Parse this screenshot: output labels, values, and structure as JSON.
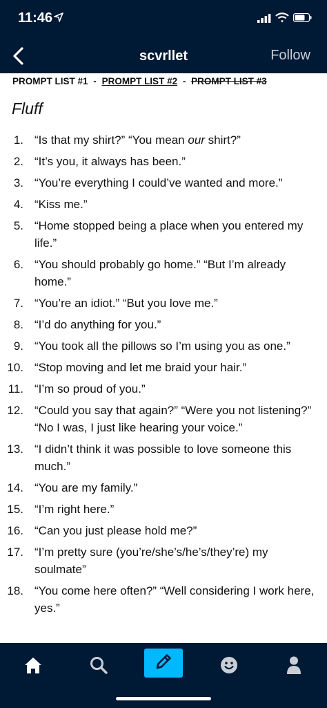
{
  "status": {
    "time": "11:46",
    "icons": [
      "location-arrow-icon",
      "signal-icon",
      "wifi-icon",
      "battery-icon"
    ]
  },
  "nav": {
    "back_icon": "chevron-left-icon",
    "title": "scvrllet",
    "follow_label": "Follow"
  },
  "prompt_links": {
    "link1": "PROMPT LIST #1",
    "sep1": "-",
    "link2": "PROMPT LIST #2",
    "sep2": "-",
    "link3": "PROMPT LIST #3"
  },
  "section_title": "Fluff",
  "prompts": [
    {
      "num": "1.",
      "text": "“Is that my shirt?” “You mean ",
      "em": "our",
      "text_after": " shirt?”"
    },
    {
      "num": "2.",
      "text": "“It’s you, it always has been.”"
    },
    {
      "num": "3.",
      "text": "“You’re everything I could’ve wanted and more.”"
    },
    {
      "num": "4.",
      "text": "“Kiss me.”"
    },
    {
      "num": "5.",
      "text": "“Home stopped being a place when you entered my life.”"
    },
    {
      "num": "6.",
      "text": "“You should probably go home.” “But I’m already home.”"
    },
    {
      "num": "7.",
      "text": "“You’re an idiot.” “But you love me.”"
    },
    {
      "num": "8.",
      "text": "“I’d do anything for you.”"
    },
    {
      "num": "9.",
      "text": "“You took all the pillows so I’m using you as one.”"
    },
    {
      "num": "10.",
      "text": "“Stop moving and let me braid your hair.”"
    },
    {
      "num": "11.",
      "text": "“I’m so proud of you.”"
    },
    {
      "num": "12.",
      "text": "“Could you say that again?” “Were you not listening?” “No I was, I just like hearing your voice.”"
    },
    {
      "num": "13.",
      "text": "“I didn’t think it was possible to love someone this much.”"
    },
    {
      "num": "14.",
      "text": "“You are my family.”"
    },
    {
      "num": "15.",
      "text": "“I’m right here.”"
    },
    {
      "num": "16.",
      "text": "“Can you just please hold me?”"
    },
    {
      "num": "17.",
      "text": "“I’m pretty sure (you’re/she’s/he’s/they’re) my soulmate”"
    },
    {
      "num": "18.",
      "text": "“You come here often?” “Well considering I work here, yes.”"
    }
  ],
  "tabs": [
    {
      "name": "home",
      "icon": "home-icon"
    },
    {
      "name": "search",
      "icon": "search-icon"
    },
    {
      "name": "compose",
      "icon": "pencil-icon"
    },
    {
      "name": "activity",
      "icon": "smiley-icon"
    },
    {
      "name": "account",
      "icon": "person-icon"
    }
  ],
  "colors": {
    "navy": "#001935",
    "accent": "#00b8ff",
    "text": "#111111",
    "follow": "#c9ced6"
  }
}
